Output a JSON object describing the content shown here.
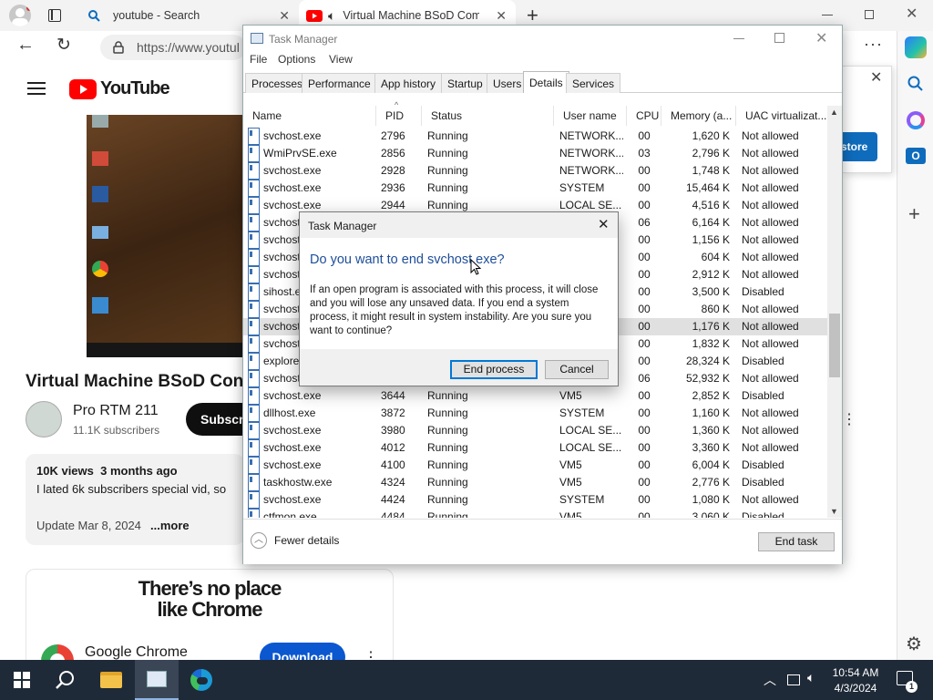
{
  "browser": {
    "tabs": [
      {
        "label": "youtube - Search"
      },
      {
        "label": "Virtual Machine BSoD Comp"
      }
    ],
    "url": "https://www.youtul"
  },
  "youtube": {
    "logo_text": "YouTube",
    "video_title": "Virtual Machine BSoD Con",
    "channel_name": "Pro RTM 211",
    "subscribers": "11.1K subscribers",
    "subscribe_label": "Subscri",
    "views_line": "10K views  3 months ago",
    "description": "I lated 6k subscribers special vid, so",
    "update_line": "Update Mar 8, 2024",
    "more_label": "...more",
    "ad": {
      "headline_1": "There’s no place",
      "headline_2": "like Chrome",
      "advertiser": "Google Chrome",
      "download_label": "Download"
    },
    "popup_button": "store"
  },
  "task_manager": {
    "title": "Task Manager",
    "menu": [
      "File",
      "Options",
      "View"
    ],
    "tabs": [
      "Processes",
      "Performance",
      "App history",
      "Startup",
      "Users",
      "Details",
      "Services"
    ],
    "columns": [
      "Name",
      "PID",
      "Status",
      "User name",
      "CPU",
      "Memory (a...",
      "UAC virtualizat..."
    ],
    "rows": [
      {
        "name": "svchost.exe",
        "pid": "2796",
        "status": "Running",
        "user": "NETWORK...",
        "cpu": "00",
        "mem": "1,620 K",
        "uac": "Not allowed"
      },
      {
        "name": "WmiPrvSE.exe",
        "pid": "2856",
        "status": "Running",
        "user": "NETWORK...",
        "cpu": "03",
        "mem": "2,796 K",
        "uac": "Not allowed"
      },
      {
        "name": "svchost.exe",
        "pid": "2928",
        "status": "Running",
        "user": "NETWORK...",
        "cpu": "00",
        "mem": "1,748 K",
        "uac": "Not allowed"
      },
      {
        "name": "svchost.exe",
        "pid": "2936",
        "status": "Running",
        "user": "SYSTEM",
        "cpu": "00",
        "mem": "15,464 K",
        "uac": "Not allowed"
      },
      {
        "name": "svchost.exe",
        "pid": "2944",
        "status": "Running",
        "user": "LOCAL SE...",
        "cpu": "00",
        "mem": "4,516 K",
        "uac": "Not allowed"
      },
      {
        "name": "svchost",
        "pid": "",
        "status": "",
        "user": "",
        "cpu": "06",
        "mem": "6,164 K",
        "uac": "Not allowed"
      },
      {
        "name": "svchost",
        "pid": "",
        "status": "",
        "user": "",
        "cpu": "00",
        "mem": "1,156 K",
        "uac": "Not allowed"
      },
      {
        "name": "svchost",
        "pid": "",
        "status": "",
        "user": "",
        "cpu": "00",
        "mem": "604 K",
        "uac": "Not allowed"
      },
      {
        "name": "svchost",
        "pid": "",
        "status": "",
        "user": "",
        "cpu": "00",
        "mem": "2,912 K",
        "uac": "Not allowed"
      },
      {
        "name": "sihost.e",
        "pid": "",
        "status": "",
        "user": "",
        "cpu": "00",
        "mem": "3,500 K",
        "uac": "Disabled"
      },
      {
        "name": "svchost",
        "pid": "",
        "status": "",
        "user": "",
        "cpu": "00",
        "mem": "860 K",
        "uac": "Not allowed"
      },
      {
        "name": "svchost",
        "pid": "",
        "status": "",
        "user": "",
        "cpu": "00",
        "mem": "1,176 K",
        "uac": "Not allowed"
      },
      {
        "name": "svchost",
        "pid": "",
        "status": "",
        "user": "",
        "cpu": "00",
        "mem": "1,832 K",
        "uac": "Not allowed"
      },
      {
        "name": "explore",
        "pid": "",
        "status": "",
        "user": "",
        "cpu": "00",
        "mem": "28,324 K",
        "uac": "Disabled"
      },
      {
        "name": "svchost",
        "pid": "",
        "status": "",
        "user": "",
        "cpu": "06",
        "mem": "52,932 K",
        "uac": "Not allowed"
      },
      {
        "name": "svchost.exe",
        "pid": "3644",
        "status": "Running",
        "user": "VM5",
        "cpu": "00",
        "mem": "2,852 K",
        "uac": "Disabled"
      },
      {
        "name": "dllhost.exe",
        "pid": "3872",
        "status": "Running",
        "user": "SYSTEM",
        "cpu": "00",
        "mem": "1,160 K",
        "uac": "Not allowed"
      },
      {
        "name": "svchost.exe",
        "pid": "3980",
        "status": "Running",
        "user": "LOCAL SE...",
        "cpu": "00",
        "mem": "1,360 K",
        "uac": "Not allowed"
      },
      {
        "name": "svchost.exe",
        "pid": "4012",
        "status": "Running",
        "user": "LOCAL SE...",
        "cpu": "00",
        "mem": "3,360 K",
        "uac": "Not allowed"
      },
      {
        "name": "svchost.exe",
        "pid": "4100",
        "status": "Running",
        "user": "VM5",
        "cpu": "00",
        "mem": "6,004 K",
        "uac": "Disabled"
      },
      {
        "name": "taskhostw.exe",
        "pid": "4324",
        "status": "Running",
        "user": "VM5",
        "cpu": "00",
        "mem": "2,776 K",
        "uac": "Disabled"
      },
      {
        "name": "svchost.exe",
        "pid": "4424",
        "status": "Running",
        "user": "SYSTEM",
        "cpu": "00",
        "mem": "1,080 K",
        "uac": "Not allowed"
      },
      {
        "name": "ctfmon.exe",
        "pid": "4484",
        "status": "Running",
        "user": "VM5",
        "cpu": "00",
        "mem": "3,060 K",
        "uac": "Disabled"
      }
    ],
    "selected_row_index": 11,
    "fewer_details": "Fewer details",
    "end_task": "End task"
  },
  "dialog": {
    "title": "Task Manager",
    "heading": "Do you want to end svchost.exe?",
    "message": "If an open program is associated with this process, it will close and you will lose any unsaved data. If you end a system process, it might result in system instability. Are you sure you want to continue?",
    "end_process": "End process",
    "cancel": "Cancel"
  },
  "taskbar": {
    "time": "10:54 AM",
    "date": "4/3/2024",
    "notification_count": "1"
  },
  "colors": {
    "dialog_heading": "#1e4e9a",
    "taskbar": "#1f2a38",
    "youtube_red": "#ff0000",
    "edge_blue": "#0f6cbd"
  }
}
